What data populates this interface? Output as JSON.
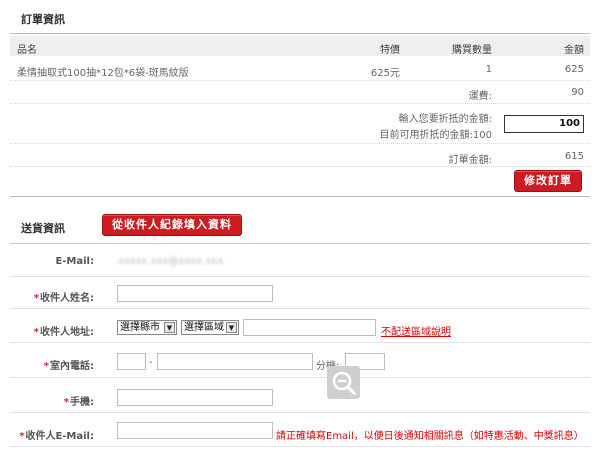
{
  "order": {
    "section_title": "訂單資訊",
    "headers": {
      "name": "品名",
      "price": "特價",
      "qty": "購買數量",
      "amount": "金額"
    },
    "item": {
      "name": "柔情抽取式100抽*12包*6袋-斑馬紋版",
      "price": "625元",
      "qty": "1",
      "amount": "625"
    },
    "shipping": {
      "label": "運費:",
      "value": "90"
    },
    "discount": {
      "label": "輸入您要折抵的金額:",
      "available_label": "目前可用折扺的金額:100",
      "input_value": "100"
    },
    "total": {
      "label": "訂單金額:",
      "value": "615"
    },
    "modify_button": "修改訂單"
  },
  "delivery": {
    "section_title": "送貨資訊",
    "fill_button": "從收件人紀錄填入資料",
    "email": {
      "label": "E-Mail:",
      "value": "xxxxx.xxx@xxxx.xxx"
    },
    "name": {
      "star": "*",
      "label": "收件人姓名:"
    },
    "address": {
      "star": "*",
      "label": "收件人地址:",
      "city_select": "選擇縣市",
      "area_select": "選擇區域",
      "link": "不配送區域說明"
    },
    "phone": {
      "star": "*",
      "label": "室內電話:",
      "dash": "-",
      "ext_label": "分機:"
    },
    "mobile": {
      "star": "*",
      "label": "手機:"
    },
    "recv_email": {
      "star": "*",
      "label": "收件人E-Mail:",
      "note": "請正確填寫Email，以便日後通知相關訊息（如特惠活動、中獎訊息）"
    }
  },
  "colors": {
    "accent": "#cc1c22",
    "note": "#dd0000",
    "header_band": "#efefef"
  },
  "icons": {
    "zoom": "zoom-out-icon",
    "select_arrow": "chevron-down-icon"
  }
}
